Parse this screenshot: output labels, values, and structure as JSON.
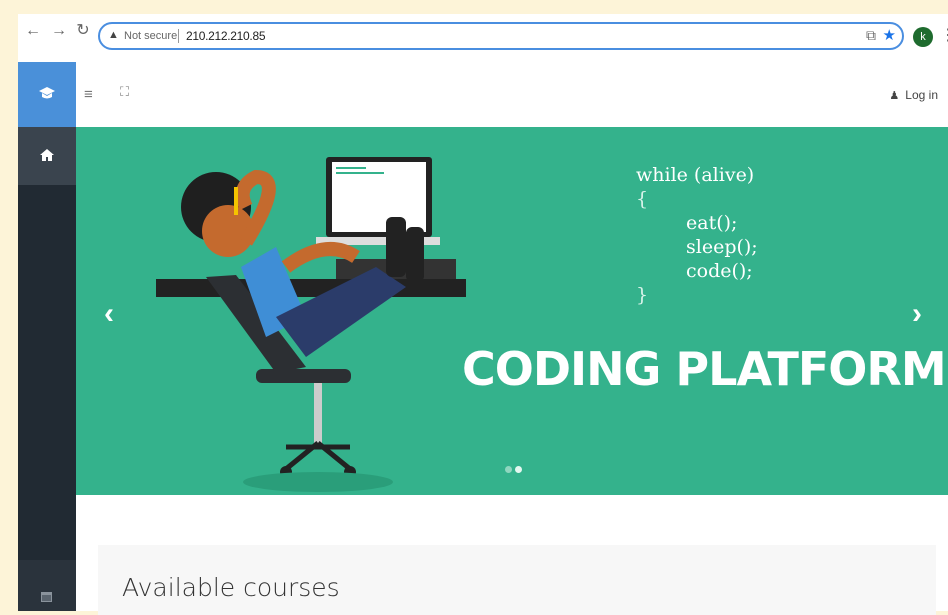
{
  "browser": {
    "security_label": "Not secure",
    "url": "210.212.210.85",
    "profile_initial": "k",
    "back_icon": "arrow-left-icon",
    "forward_icon": "arrow-right-icon",
    "reload_icon": "reload-icon"
  },
  "header": {
    "login_label": "Log in"
  },
  "hero": {
    "code_lines": [
      "while (alive)",
      "{",
      "eat();",
      "sleep();",
      "code();",
      "}"
    ],
    "title": "CODING PLATFORM",
    "slide_count": 2,
    "active_slide": 2
  },
  "main": {
    "section_title": "Available courses"
  },
  "colors": {
    "sidebar": "#212a33",
    "sidebar_accent": "#4a90d9",
    "hero_bg": "#34b28c"
  }
}
